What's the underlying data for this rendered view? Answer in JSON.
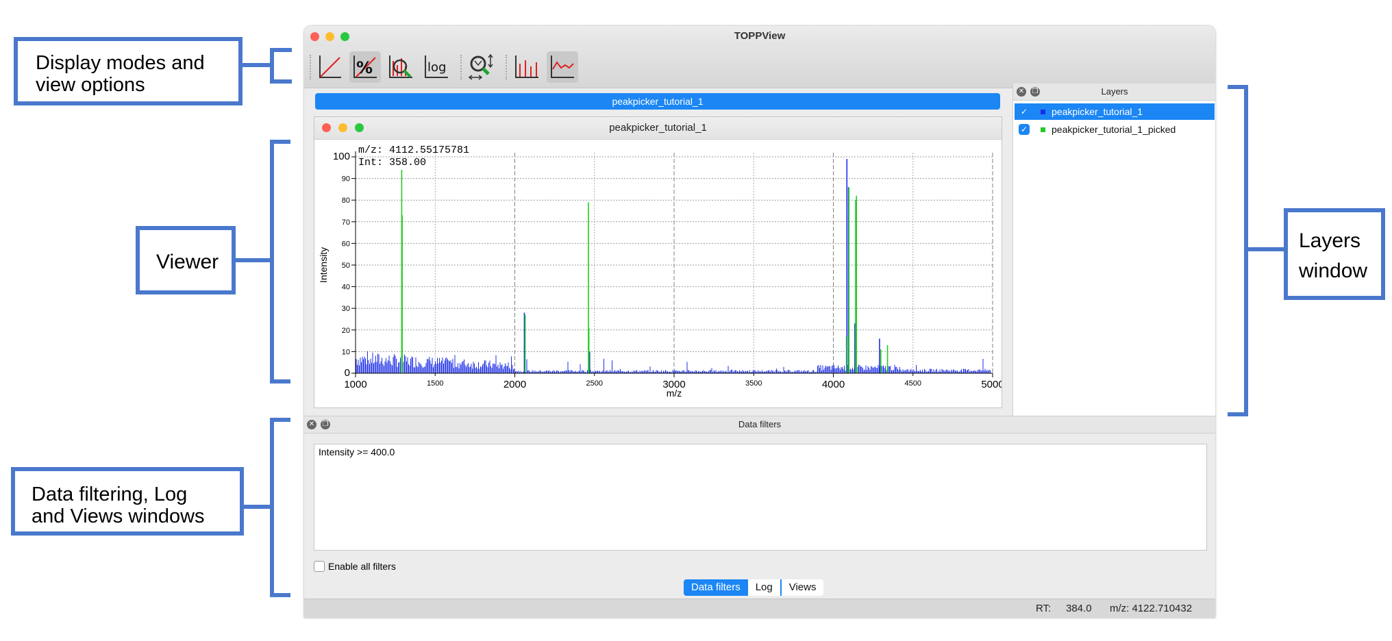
{
  "callouts": {
    "display_modes": "Display modes and\nview options",
    "viewer": "Viewer",
    "layers": "Layers\nwindow",
    "data_filtering": "Data filtering, Log\nand Views windows"
  },
  "app": {
    "title": "TOPPView",
    "toolbar": {
      "buttons": [
        "linear-intensity-icon",
        "percentage-intensity-icon",
        "snap-to-max-icon",
        "log-intensity-icon",
        "zoom-icon",
        "peaks-mode-icon",
        "raw-mode-icon"
      ],
      "log_label": "log"
    },
    "spectrum_tab": "peakpicker_tutorial_1",
    "viewer": {
      "window_title": "peakpicker_tutorial_1",
      "cursor_mz": "m/z: 4112.55175781",
      "cursor_int": "Int: 358.00"
    },
    "layers": {
      "title": "Layers",
      "items": [
        {
          "name": "peakpicker_tutorial_1",
          "color": "#1b2ee6",
          "checked": true,
          "selected": true
        },
        {
          "name": "peakpicker_tutorial_1_picked",
          "color": "#22cc22",
          "checked": true,
          "selected": false
        }
      ]
    },
    "data_filters": {
      "title": "Data filters",
      "filter_text": "Intensity >= 400.0",
      "enable_label": "Enable all filters"
    },
    "tabs": [
      "Data filters",
      "Log",
      "Views"
    ],
    "status": {
      "rt_label": "RT:",
      "rt_value": "384.0",
      "mz": "m/z: 4122.710432"
    }
  },
  "chart_data": {
    "type": "line",
    "xlabel": "m/z",
    "ylabel": "Intensity",
    "xlim": [
      1000,
      5000
    ],
    "ylim": [
      0,
      100
    ],
    "x_ticks_major": [
      1000,
      2000,
      3000,
      4000,
      5000
    ],
    "x_ticks_minor": [
      1500,
      2500,
      3500,
      4500
    ],
    "y_ticks": [
      0,
      10,
      20,
      30,
      40,
      50,
      60,
      70,
      80,
      90,
      100
    ],
    "grid": true,
    "series": [
      {
        "name": "peakpicker_tutorial_1",
        "color": "#1b2ee6",
        "peaks": [
          [
            1290,
            8
          ],
          [
            2060,
            28
          ],
          [
            2470,
            10
          ],
          [
            4085,
            99
          ],
          [
            4095,
            86
          ],
          [
            4135,
            23
          ],
          [
            4290,
            16
          ]
        ]
      },
      {
        "name": "peakpicker_tutorial_1_picked",
        "color": "#22cc22",
        "peaks": [
          [
            1290,
            94
          ],
          [
            1293,
            73
          ],
          [
            2065,
            27
          ],
          [
            2462,
            79
          ],
          [
            2465,
            21
          ],
          [
            4082,
            17
          ],
          [
            4098,
            86
          ],
          [
            4140,
            80
          ],
          [
            4145,
            82
          ],
          [
            4298,
            11
          ],
          [
            4340,
            13
          ]
        ]
      }
    ]
  }
}
